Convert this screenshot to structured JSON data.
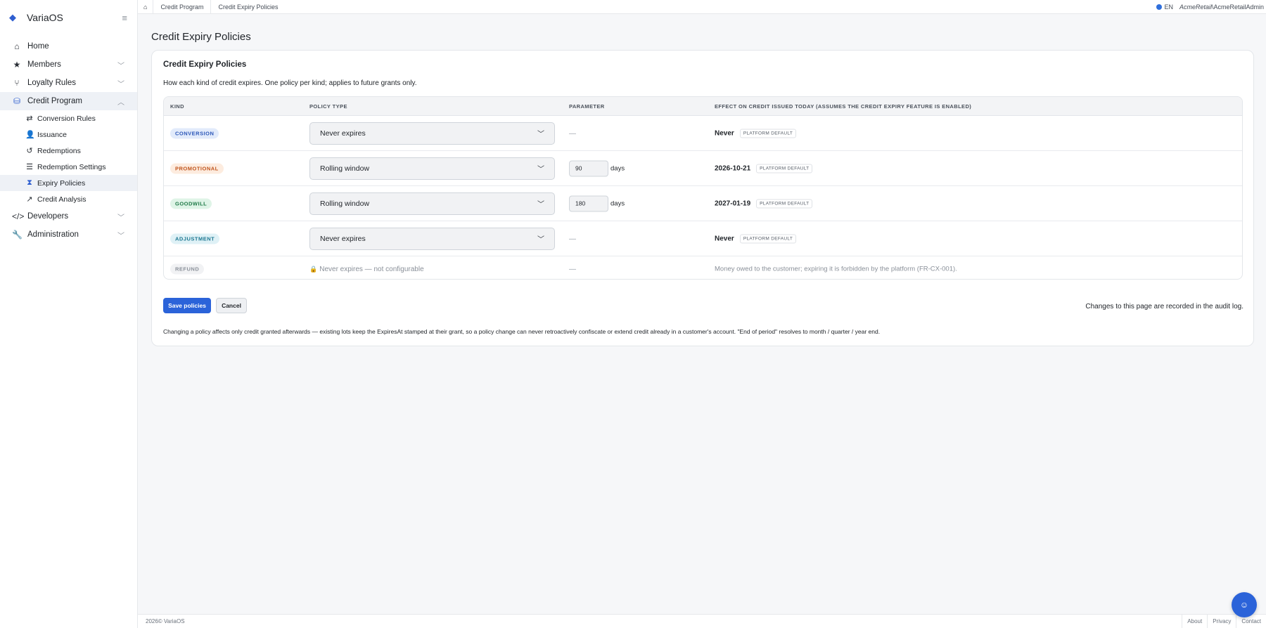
{
  "app": {
    "name": "VariaOS",
    "logo_icon": "diamond-icon",
    "colors": {
      "accent": "#2b63d9",
      "sidebar_active_bg": "#eef1f6"
    }
  },
  "sidebar": {
    "items": [
      {
        "label": "Home",
        "icon": "home-icon",
        "expandable": false
      },
      {
        "label": "Members",
        "icon": "star-icon",
        "expandable": true
      },
      {
        "label": "Loyalty Rules",
        "icon": "branch-icon",
        "expandable": true
      },
      {
        "label": "Credit Program",
        "icon": "coins-icon",
        "expandable": true,
        "open": true,
        "children": [
          {
            "label": "Conversion Rules",
            "icon": "swap-icon"
          },
          {
            "label": "Issuance",
            "icon": "user-plus-icon"
          },
          {
            "label": "Redemptions",
            "icon": "history-icon"
          },
          {
            "label": "Redemption Settings",
            "icon": "sliders-icon"
          },
          {
            "label": "Expiry Policies",
            "icon": "hourglass-icon",
            "active": true
          },
          {
            "label": "Credit Analysis",
            "icon": "chart-line-icon"
          }
        ]
      },
      {
        "label": "Developers",
        "icon": "code-icon",
        "expandable": true
      },
      {
        "label": "Administration",
        "icon": "wrench-icon",
        "expandable": true
      }
    ]
  },
  "topbar": {
    "breadcrumb": [
      "Credit Program",
      "Credit Expiry Policies"
    ],
    "language": "EN",
    "user_tenant": "AcmeRetail",
    "user_name": "\\AcmeRetailAdmin"
  },
  "page": {
    "title": "Credit Expiry Policies",
    "card_title": "Credit Expiry Policies",
    "card_description": "How each kind of credit expires. One policy per kind; applies to future grants only.",
    "table": {
      "headers": {
        "kind": "KIND",
        "policy_type": "POLICY TYPE",
        "parameter": "PARAMETER",
        "effect": "EFFECT ON CREDIT ISSUED TODAY (ASSUMES THE CREDIT EXPIRY FEATURE IS ENABLED)"
      },
      "rows": [
        {
          "kind": "CONVERSION",
          "policy": "Never expires",
          "parameter": "—",
          "effect": "Never",
          "badge": "PLATFORM DEFAULT"
        },
        {
          "kind": "PROMOTIONAL",
          "policy": "Rolling window",
          "parameter": "90",
          "unit": "days",
          "effect": "2026-10-21",
          "badge": "PLATFORM DEFAULT"
        },
        {
          "kind": "GOODWILL",
          "policy": "Rolling window",
          "parameter": "180",
          "unit": "days",
          "effect": "2027-01-19",
          "badge": "PLATFORM DEFAULT"
        },
        {
          "kind": "ADJUSTMENT",
          "policy": "Never expires",
          "parameter": "—",
          "effect": "Never",
          "badge": "PLATFORM DEFAULT"
        },
        {
          "kind": "REFUND",
          "policy": "Never expires — not configurable",
          "parameter": "—",
          "effect": "Money owed to the customer; expiring it is forbidden by the platform (FR-CX-001)."
        }
      ],
      "pill_colors": {
        "CONVERSION": {
          "bg": "#e2ebfb",
          "fg": "#2b56b8"
        },
        "PROMOTIONAL": {
          "bg": "#fdecdf",
          "fg": "#c0541c"
        },
        "GOODWILL": {
          "bg": "#dff4e7",
          "fg": "#1f7a47"
        },
        "ADJUSTMENT": {
          "bg": "#dff1f6",
          "fg": "#1c7791"
        },
        "REFUND": {
          "bg": "#f1f2f4",
          "fg": "#8a9099"
        }
      }
    },
    "save_label": "Save policies",
    "cancel_label": "Cancel",
    "audit_note": "Changes to this page are recorded in the audit log.",
    "footnote": "Changing a policy affects only credit granted afterwards — existing lots keep the ExpiresAt stamped at their grant, so a policy change can never retroactively confiscate or extend credit already in a customer's account. \"End of period\" resolves to month / quarter / year end."
  },
  "footer": {
    "copyright": "2026© VariaOS",
    "links": [
      "About",
      "Privacy",
      "Contact"
    ]
  },
  "fab": {
    "icon": "chat-bot-icon"
  }
}
